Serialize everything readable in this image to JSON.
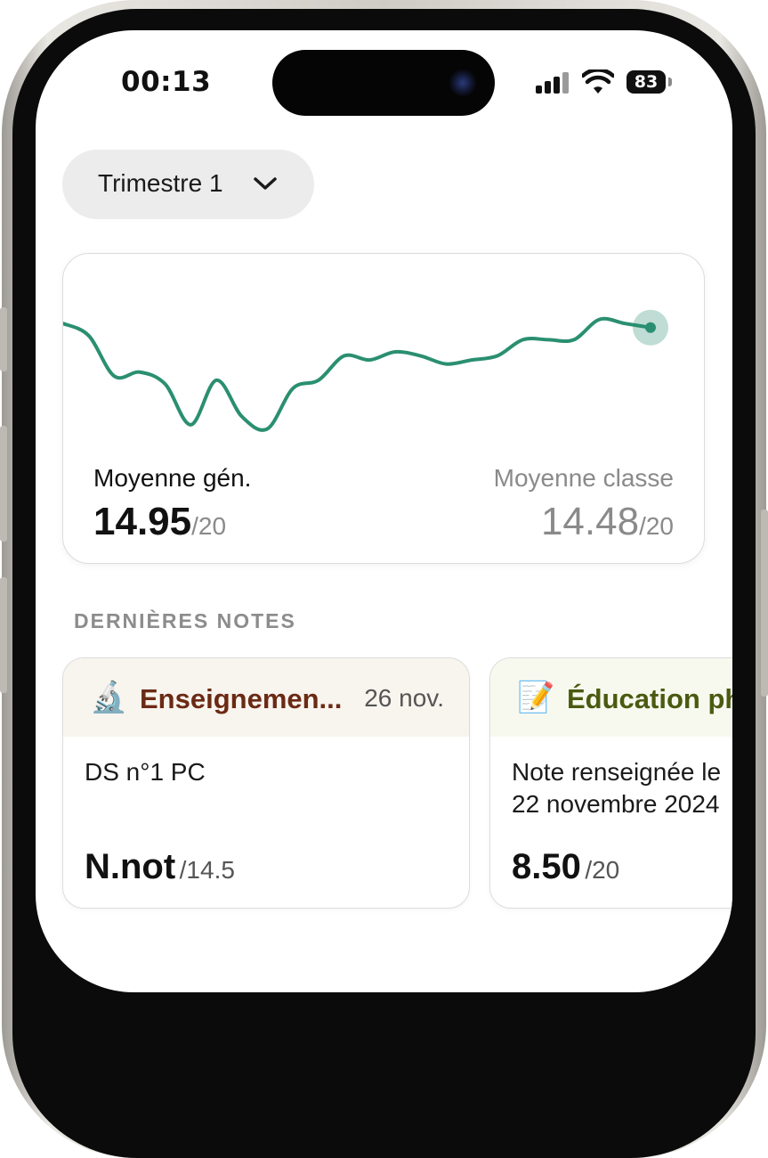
{
  "status_bar": {
    "time": "00:13",
    "battery": "83"
  },
  "period_selector": {
    "label": "Trimestre 1"
  },
  "chart_data": {
    "type": "line",
    "values": [
      12.9,
      12.6,
      11.6,
      11.7,
      11.4,
      10.4,
      11.5,
      10.6,
      10.3,
      11.3,
      11.5,
      12.1,
      12.0,
      12.2,
      12.1,
      11.9,
      12.0,
      12.1,
      12.5,
      12.5,
      12.5,
      13.0,
      12.9,
      12.8
    ],
    "accent": "#2a8f70"
  },
  "averages": {
    "general_label": "Moyenne gén.",
    "general_value": "14.95",
    "general_scale": "/20",
    "class_label": "Moyenne classe",
    "class_value": "14.48",
    "class_scale": "/20"
  },
  "section": {
    "title": "DERNIÈRES NOTES"
  },
  "grades": [
    {
      "icon": "microscope-icon",
      "emoji": "🔬",
      "subject": "Enseignemen...",
      "subject_color": "#6b2a14",
      "header_bg": "#f8f4ee",
      "date": "26 nov.",
      "description": "DS n°1 PC",
      "value": "N.not",
      "scale": "/14.5"
    },
    {
      "icon": "memo-icon",
      "emoji": "📝",
      "subject": "Éducation physique",
      "subject_color": "#4a5a10",
      "header_bg": "#f7f9ef",
      "date": "",
      "description_line1": "Note renseignée le",
      "description_line2": "22 novembre 2024",
      "value": "8.50",
      "scale": "/20"
    }
  ]
}
